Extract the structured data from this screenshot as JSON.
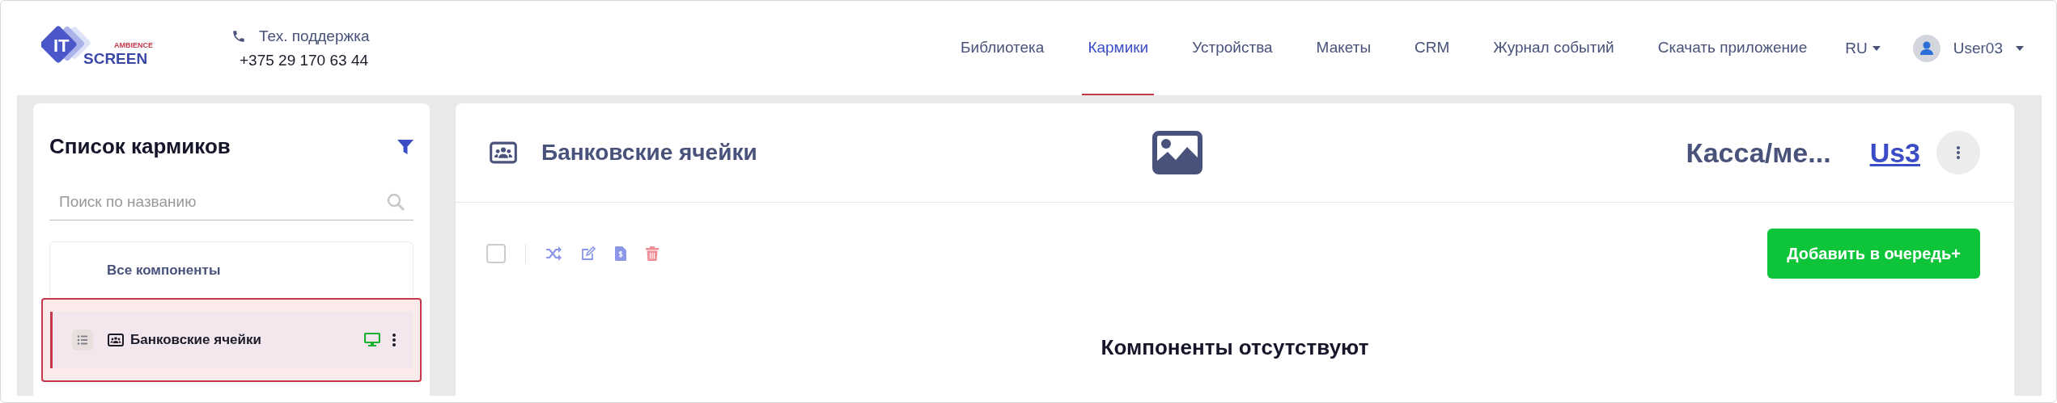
{
  "logo": {
    "mark": "IT",
    "tag": "AMBIENCE",
    "name": "SCREEN"
  },
  "support": {
    "label": "Тех. поддержка",
    "phone": "+375 29 170 63 44"
  },
  "nav": [
    {
      "label": "Библиотека",
      "selected": false
    },
    {
      "label": "Кармики",
      "selected": true
    },
    {
      "label": "Устройства",
      "selected": false
    },
    {
      "label": "Макеты",
      "selected": false
    },
    {
      "label": "CRM",
      "selected": false
    },
    {
      "label": "Журнал событий",
      "selected": false
    },
    {
      "label": "Скачать приложение",
      "selected": false
    }
  ],
  "language": "RU",
  "user": "User03",
  "sidebar": {
    "title": "Список кармиков",
    "search": {
      "placeholder": "Поиск по названию"
    },
    "items": [
      {
        "kind": "all",
        "label": "Все компоненты",
        "selected": false
      },
      {
        "kind": "group",
        "label": "Банковские ячейки",
        "selected": true,
        "online": true
      }
    ]
  },
  "main": {
    "title": "Банковские ячейки",
    "location": "Касса/ме...",
    "user_link": "Us3",
    "select_all": {
      "checked": false
    },
    "add_button": "Добавить в очередь+",
    "empty": "Компоненты отсутствуют"
  }
}
